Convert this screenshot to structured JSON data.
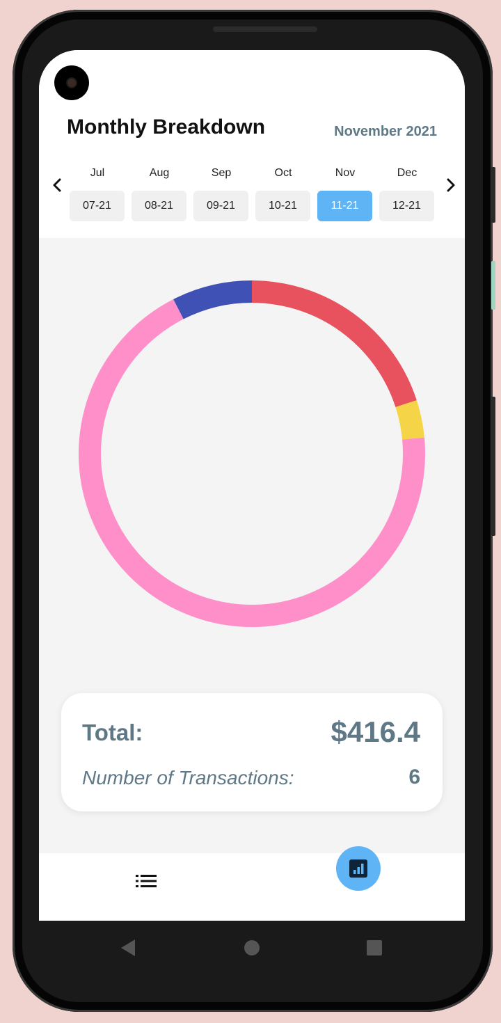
{
  "header": {
    "title": "Monthly Breakdown",
    "current_month": "November 2021"
  },
  "months": [
    {
      "name": "Jul",
      "code": "07-21",
      "selected": false
    },
    {
      "name": "Aug",
      "code": "08-21",
      "selected": false
    },
    {
      "name": "Sep",
      "code": "09-21",
      "selected": false
    },
    {
      "name": "Oct",
      "code": "10-21",
      "selected": false
    },
    {
      "name": "Nov",
      "code": "11-21",
      "selected": true
    },
    {
      "name": "Dec",
      "code": "12-21",
      "selected": false
    }
  ],
  "chart_data": {
    "type": "pie",
    "variant": "donut",
    "values": [
      20,
      3.5,
      69,
      7.5
    ],
    "colors": [
      "#e8525f",
      "#f5d547",
      "#fe8fc8",
      "#3f51b5"
    ]
  },
  "summary": {
    "total_label": "Total:",
    "total_value": "$416.4",
    "transactions_label": "Number of Transactions:",
    "transactions_value": "6"
  },
  "nav": {
    "list_icon": "list-icon",
    "chart_icon": "bar-chart-icon"
  },
  "colors": {
    "accent": "#5fb4f5",
    "text_muted": "#5e7886",
    "background": "#f4f4f4"
  }
}
